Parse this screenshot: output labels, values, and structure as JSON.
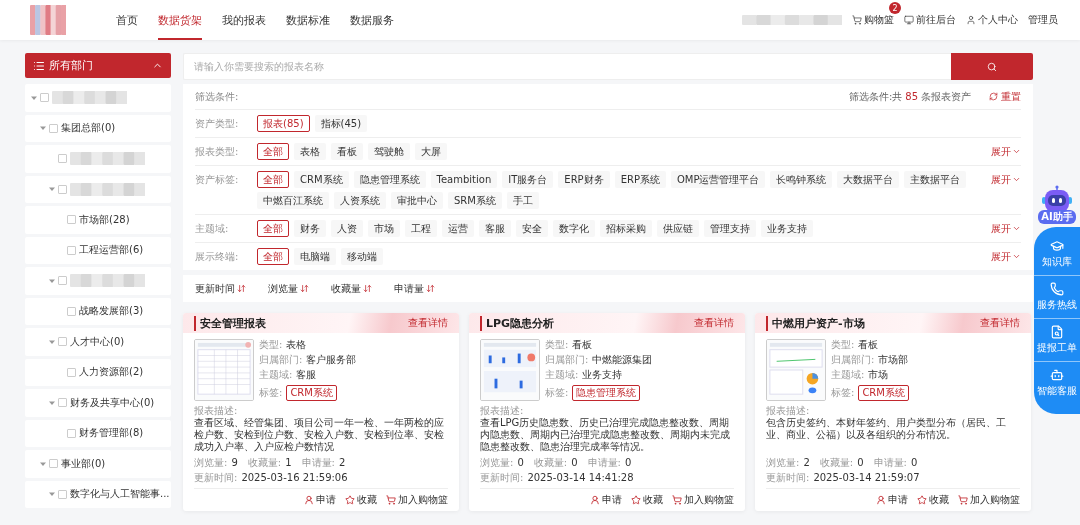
{
  "header": {
    "nav": [
      {
        "label": "首页",
        "selected": false
      },
      {
        "label": "数据货架",
        "selected": true
      },
      {
        "label": "我的报表",
        "selected": false
      },
      {
        "label": "数据标准",
        "selected": false
      },
      {
        "label": "数据服务",
        "selected": false
      }
    ],
    "actions": [
      {
        "kind": "cart",
        "label": "购物篮",
        "badge": "2"
      },
      {
        "kind": "backend",
        "label": "前往后台"
      },
      {
        "kind": "user",
        "label": "个人中心"
      },
      {
        "kind": "plain",
        "label": "管理员"
      }
    ]
  },
  "sidebar": {
    "title": "所有部门",
    "expanded": true,
    "tree": [
      {
        "kind": "blurred",
        "checked": false,
        "expanded": true,
        "children": [
          {
            "label": "集团总部(0)",
            "checked": false,
            "expanded": true,
            "children": [
              {
                "kind": "blurred",
                "checked": false
              },
              {
                "kind": "blurred",
                "checked": false,
                "expanded": true,
                "children": [
                  {
                    "label": "市场部(28)",
                    "checked": false
                  },
                  {
                    "label": "工程运营部(6)",
                    "checked": false
                  }
                ]
              },
              {
                "kind": "blurred",
                "checked": false,
                "expanded": true,
                "children": [
                  {
                    "label": "战略发展部(3)",
                    "checked": false
                  }
                ]
              },
              {
                "label": "人才中心(0)",
                "checked": false,
                "expanded": true,
                "children": [
                  {
                    "label": "人力资源部(2)",
                    "checked": false
                  }
                ]
              },
              {
                "label": "财务及共享中心(0)",
                "checked": false,
                "expanded": true,
                "children": [
                  {
                    "label": "财务管理部(8)",
                    "checked": false
                  }
                ]
              }
            ]
          },
          {
            "label": "事业部(0)",
            "checked": false,
            "expanded": true,
            "children": [
              {
                "label": "数字化与人工智能事...",
                "checked": false,
                "expanded": true
              }
            ]
          }
        ]
      }
    ]
  },
  "search": {
    "placeholder": "请输入你需要搜索的报表名称"
  },
  "filters": {
    "title": "筛选条件:",
    "summary_prefix": "筛选条件:共",
    "summary_count": "85",
    "summary_suffix": "条报表资产",
    "reset": "重置",
    "rows": [
      {
        "label": "资产类型:",
        "options": [
          {
            "label": "报表(85)",
            "selected": true
          },
          {
            "label": "指标(45)",
            "selected": false
          }
        ]
      },
      {
        "label": "报表类型:",
        "expand": "展开",
        "options": [
          {
            "label": "全部",
            "selected": true
          },
          {
            "label": "表格",
            "selected": false
          },
          {
            "label": "看板",
            "selected": false
          },
          {
            "label": "驾驶舱",
            "selected": false
          },
          {
            "label": "大屏",
            "selected": false
          }
        ]
      },
      {
        "label": "资产标签:",
        "expand": "展开",
        "options": [
          {
            "label": "全部",
            "selected": true
          },
          {
            "label": "CRM系统",
            "selected": false
          },
          {
            "label": "隐患管理系统",
            "selected": false
          },
          {
            "label": "Teambition",
            "selected": false
          },
          {
            "label": "IT服务台",
            "selected": false
          },
          {
            "label": "ERP财务",
            "selected": false
          },
          {
            "label": "ERP系统",
            "selected": false
          },
          {
            "label": "OMP运营管理平台",
            "selected": false
          },
          {
            "label": "长鸣钟系统",
            "selected": false
          },
          {
            "label": "大数据平台",
            "selected": false
          },
          {
            "label": "主数据平台",
            "selected": false
          },
          {
            "label": "中燃百江系统",
            "selected": false
          },
          {
            "label": "人资系统",
            "selected": false
          },
          {
            "label": "审批中心",
            "selected": false
          },
          {
            "label": "SRM系统",
            "selected": false
          },
          {
            "label": "手工",
            "selected": false
          }
        ]
      },
      {
        "label": "主题域:",
        "expand": "展开",
        "options": [
          {
            "label": "全部",
            "selected": true
          },
          {
            "label": "财务",
            "selected": false
          },
          {
            "label": "人资",
            "selected": false
          },
          {
            "label": "市场",
            "selected": false
          },
          {
            "label": "工程",
            "selected": false
          },
          {
            "label": "运营",
            "selected": false
          },
          {
            "label": "客服",
            "selected": false
          },
          {
            "label": "安全",
            "selected": false
          },
          {
            "label": "数字化",
            "selected": false
          },
          {
            "label": "招标采购",
            "selected": false
          },
          {
            "label": "供应链",
            "selected": false
          },
          {
            "label": "管理支持",
            "selected": false
          },
          {
            "label": "业务支持",
            "selected": false
          }
        ]
      },
      {
        "label": "展示终端:",
        "expand": "展开",
        "options": [
          {
            "label": "全部",
            "selected": true
          },
          {
            "label": "电脑端",
            "selected": false
          },
          {
            "label": "移动端",
            "selected": false
          }
        ]
      }
    ]
  },
  "sort": [
    "更新时间",
    "浏览量",
    "收藏量",
    "申请量"
  ],
  "cards": [
    {
      "title": "安全管理报表",
      "link": "查看详情",
      "fields": [
        {
          "label": "类型:",
          "value": "表格"
        },
        {
          "label": "归属部门:",
          "value": "客户服务部"
        },
        {
          "label": "主题域:",
          "value": "客服"
        }
      ],
      "tag_label": "标签:",
      "tag": "CRM系统",
      "desc_label": "报表描述:",
      "desc": "查看区域、经管集团、项目公司一年一检、一年两检的应检户数、安检到位户数、安检入户数、安检到位率、安检成功入户率、入户应检户数情况",
      "stats": [
        {
          "label": "浏览量:",
          "value": "9"
        },
        {
          "label": "收藏量:",
          "value": "1"
        },
        {
          "label": "申请量:",
          "value": "2"
        }
      ],
      "updated_label": "更新时间:",
      "updated": "2025-03-16 21:59:06",
      "actions": [
        {
          "kind": "apply",
          "label": "申请"
        },
        {
          "kind": "star",
          "label": "收藏"
        },
        {
          "kind": "cart",
          "label": "加入购物篮"
        }
      ]
    },
    {
      "title": "LPG隐患分析",
      "link": "查看详情",
      "fields": [
        {
          "label": "类型:",
          "value": "看板"
        },
        {
          "label": "归属部门:",
          "value": "中燃能源集团"
        },
        {
          "label": "主题域:",
          "value": "业务支持"
        }
      ],
      "tag_label": "标签:",
      "tag": "隐患管理系统",
      "desc_label": "报表描述:",
      "desc": "查看LPG历史隐患数、历史已治理完成隐患整改数、周期内隐患数、周期内已治理完成隐患整改数、周期内未完成隐患整改数、隐患治理完成率等情况。",
      "stats": [
        {
          "label": "浏览量:",
          "value": "0"
        },
        {
          "label": "收藏量:",
          "value": "0"
        },
        {
          "label": "申请量:",
          "value": "0"
        }
      ],
      "updated_label": "更新时间:",
      "updated": "2025-03-14 14:41:28",
      "actions": [
        {
          "kind": "apply",
          "label": "申请"
        },
        {
          "kind": "star",
          "label": "收藏"
        },
        {
          "kind": "cart",
          "label": "加入购物篮"
        }
      ]
    },
    {
      "title": "中燃用户资产-市场",
      "link": "查看详情",
      "fields": [
        {
          "label": "类型:",
          "value": "看板"
        },
        {
          "label": "归属部门:",
          "value": "市场部"
        },
        {
          "label": "主题域:",
          "value": "市场"
        }
      ],
      "tag_label": "标签:",
      "tag": "CRM系统",
      "desc_label": "报表描述:",
      "desc": "包含历史签约、本财年签约、用户类型分布（居民、工业、商业、公福）以及各组织的分布情况。",
      "stats": [
        {
          "label": "浏览量:",
          "value": "2"
        },
        {
          "label": "收藏量:",
          "value": "0"
        },
        {
          "label": "申请量:",
          "value": "0"
        }
      ],
      "updated_label": "更新时间:",
      "updated": "2025-03-14 21:59:07",
      "actions": [
        {
          "kind": "apply",
          "label": "申请"
        },
        {
          "kind": "star",
          "label": "收藏"
        },
        {
          "kind": "cart",
          "label": "加入购物篮"
        }
      ]
    }
  ],
  "float": {
    "ai_label": "AI助手",
    "items": [
      {
        "kind": "knowledge",
        "label": "知识库"
      },
      {
        "kind": "phone",
        "label": "服务热线"
      },
      {
        "kind": "ticket",
        "label": "提报工单"
      },
      {
        "kind": "bot",
        "label": "智能客服"
      }
    ]
  }
}
